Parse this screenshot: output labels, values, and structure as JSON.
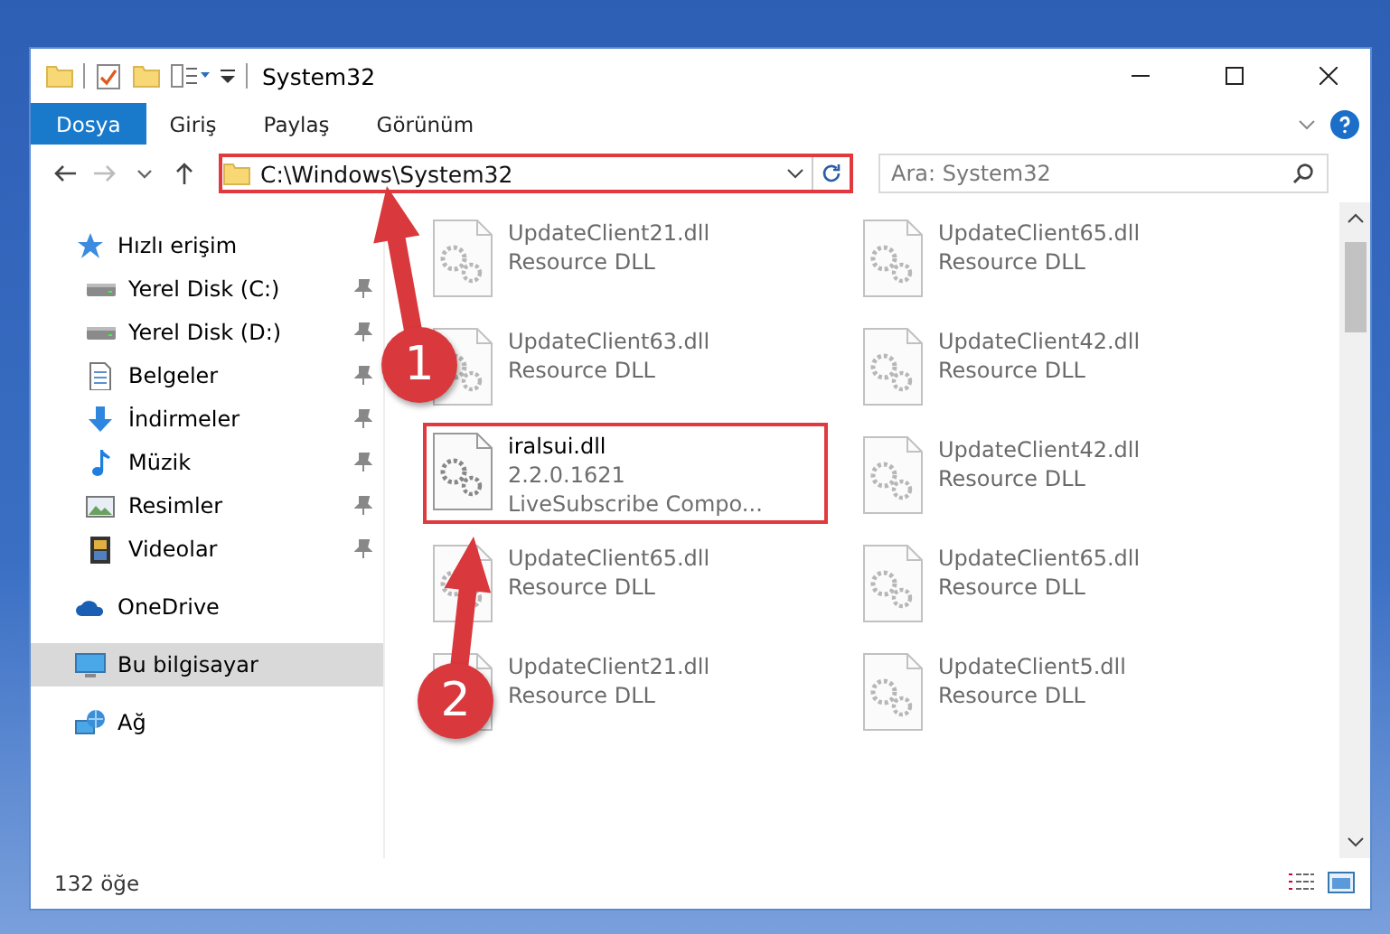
{
  "window": {
    "title": "System32"
  },
  "ribbon": {
    "tabs": [
      {
        "label": "Dosya",
        "kind": "file"
      },
      {
        "label": "Giriş",
        "kind": "tab"
      },
      {
        "label": "Paylaş",
        "kind": "tab"
      },
      {
        "label": "Görünüm",
        "kind": "tab"
      }
    ]
  },
  "address": {
    "path": "C:\\Windows\\System32",
    "highlighted": true
  },
  "search": {
    "placeholder": "Ara: System32"
  },
  "sidebar": {
    "items": [
      {
        "label": "Hızlı erişim",
        "kind": "star",
        "selected": false,
        "children": [
          {
            "label": "Yerel Disk (C:)",
            "kind": "drive",
            "pinned": true
          },
          {
            "label": "Yerel Disk (D:)",
            "kind": "drive",
            "pinned": true
          },
          {
            "label": "Belgeler",
            "kind": "doc",
            "pinned": true
          },
          {
            "label": "İndirmeler",
            "kind": "download",
            "pinned": true
          },
          {
            "label": "Müzik",
            "kind": "music",
            "pinned": true
          },
          {
            "label": "Resimler",
            "kind": "image",
            "pinned": true
          },
          {
            "label": "Videolar",
            "kind": "video",
            "pinned": true
          }
        ]
      },
      {
        "label": "OneDrive",
        "kind": "cloud",
        "selected": false
      },
      {
        "label": "Bu bilgisayar",
        "kind": "pc",
        "selected": true
      },
      {
        "label": "Ağ",
        "kind": "network",
        "selected": false
      }
    ]
  },
  "files": [
    {
      "name": "UpdateClient21.dll",
      "details": [
        "Resource DLL"
      ],
      "blurred": true,
      "highlighted": false
    },
    {
      "name": "UpdateClient65.dll",
      "details": [
        "Resource DLL"
      ],
      "blurred": true,
      "highlighted": false
    },
    {
      "name": "UpdateClient63.dll",
      "details": [
        "Resource DLL"
      ],
      "blurred": true,
      "highlighted": false
    },
    {
      "name": "UpdateClient42.dll",
      "details": [
        "Resource DLL"
      ],
      "blurred": true,
      "highlighted": false
    },
    {
      "name": "iralsui.dll",
      "details": [
        "2.2.0.1621",
        "LiveSubscribe Compo..."
      ],
      "blurred": false,
      "highlighted": true
    },
    {
      "name": "UpdateClient42.dll",
      "details": [
        "Resource DLL"
      ],
      "blurred": true,
      "highlighted": false
    },
    {
      "name": "UpdateClient65.dll",
      "details": [
        "Resource DLL"
      ],
      "blurred": true,
      "highlighted": false
    },
    {
      "name": "UpdateClient65.dll",
      "details": [
        "Resource DLL"
      ],
      "blurred": true,
      "highlighted": false
    },
    {
      "name": "UpdateClient21.dll",
      "details": [
        "Resource DLL"
      ],
      "blurred": true,
      "highlighted": false
    },
    {
      "name": "UpdateClient5.dll",
      "details": [
        "Resource DLL"
      ],
      "blurred": true,
      "highlighted": false
    }
  ],
  "callouts": [
    {
      "number": "1"
    },
    {
      "number": "2"
    }
  ],
  "status_bar": {
    "count": "132 öğe"
  }
}
